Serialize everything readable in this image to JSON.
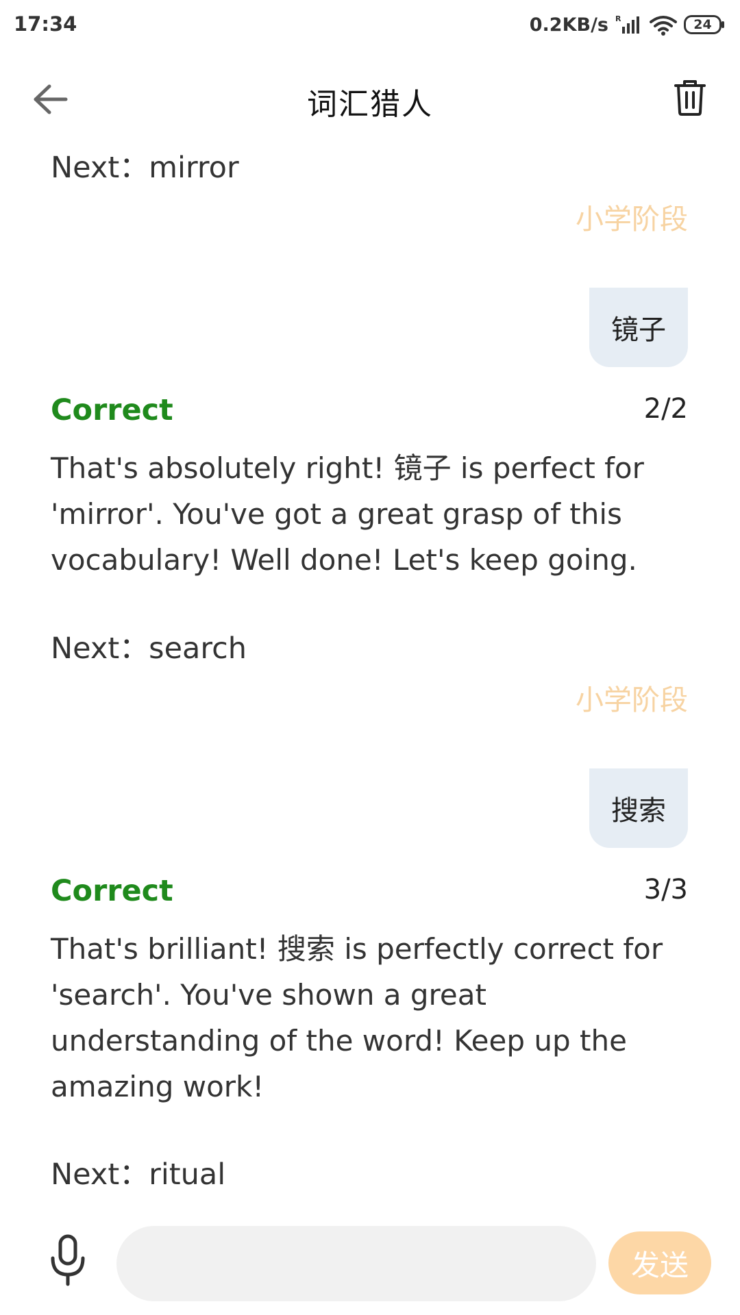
{
  "status_bar": {
    "time": "17:34",
    "network_speed": "0.2KB/s",
    "battery_level": "24",
    "icons": [
      "signal-icon",
      "wifi-icon",
      "battery-icon"
    ]
  },
  "header": {
    "title": "词汇猎人",
    "back_icon": "arrow-left-icon",
    "delete_icon": "trash-icon"
  },
  "messages": [
    {
      "type": "prompt",
      "text": "Next：mirror"
    },
    {
      "type": "stage",
      "text": "小学阶段"
    },
    {
      "type": "user",
      "text": "镜子"
    },
    {
      "type": "feedback",
      "result": "Correct",
      "count": "2/2",
      "text": "That's absolutely right!  镜子 is perfect for 'mirror'. You've got a great grasp of this vocabulary! Well done! Let's keep going."
    },
    {
      "type": "prompt",
      "text": "Next：search"
    },
    {
      "type": "stage",
      "text": "小学阶段"
    },
    {
      "type": "user",
      "text": "搜索"
    },
    {
      "type": "feedback",
      "result": "Correct",
      "count": "3/3",
      "text": "That's brilliant!  搜索 is perfectly correct for 'search'. You've shown a great understanding of the word! Keep up the amazing work!"
    },
    {
      "type": "prompt",
      "text": "Next：ritual"
    }
  ],
  "input": {
    "value": "",
    "placeholder": "",
    "send_label": "发送",
    "mic_icon": "microphone-icon"
  },
  "colors": {
    "correct": "#1f8a1c",
    "stage_tag": "#f7d3a2",
    "user_bubble": "#e6edf4",
    "send_button": "#fdd7a6",
    "input_background": "#f1f1f1"
  }
}
